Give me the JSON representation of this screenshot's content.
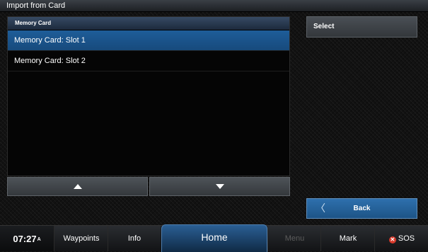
{
  "window": {
    "title": "Import from Card"
  },
  "list": {
    "header": "Memory Card",
    "items": [
      {
        "label": "Memory Card: Slot 1",
        "selected": true
      },
      {
        "label": "Memory Card: Slot 2",
        "selected": false
      }
    ]
  },
  "scroll": {
    "up_icon": "arrow-up-icon",
    "down_icon": "arrow-down-icon"
  },
  "actions": {
    "select_label": "Select",
    "back_label": "Back",
    "back_icon": "chevron-left-icon"
  },
  "bottom_bar": {
    "time": "07:27",
    "ampm": "A",
    "tabs": {
      "waypoints": "Waypoints",
      "info": "Info",
      "home": "Home",
      "menu": "Menu",
      "mark": "Mark",
      "sos": "SOS"
    }
  },
  "colors": {
    "accent": "#1e5d99",
    "selection": "#174a7c",
    "sos": "#d83a2c"
  }
}
